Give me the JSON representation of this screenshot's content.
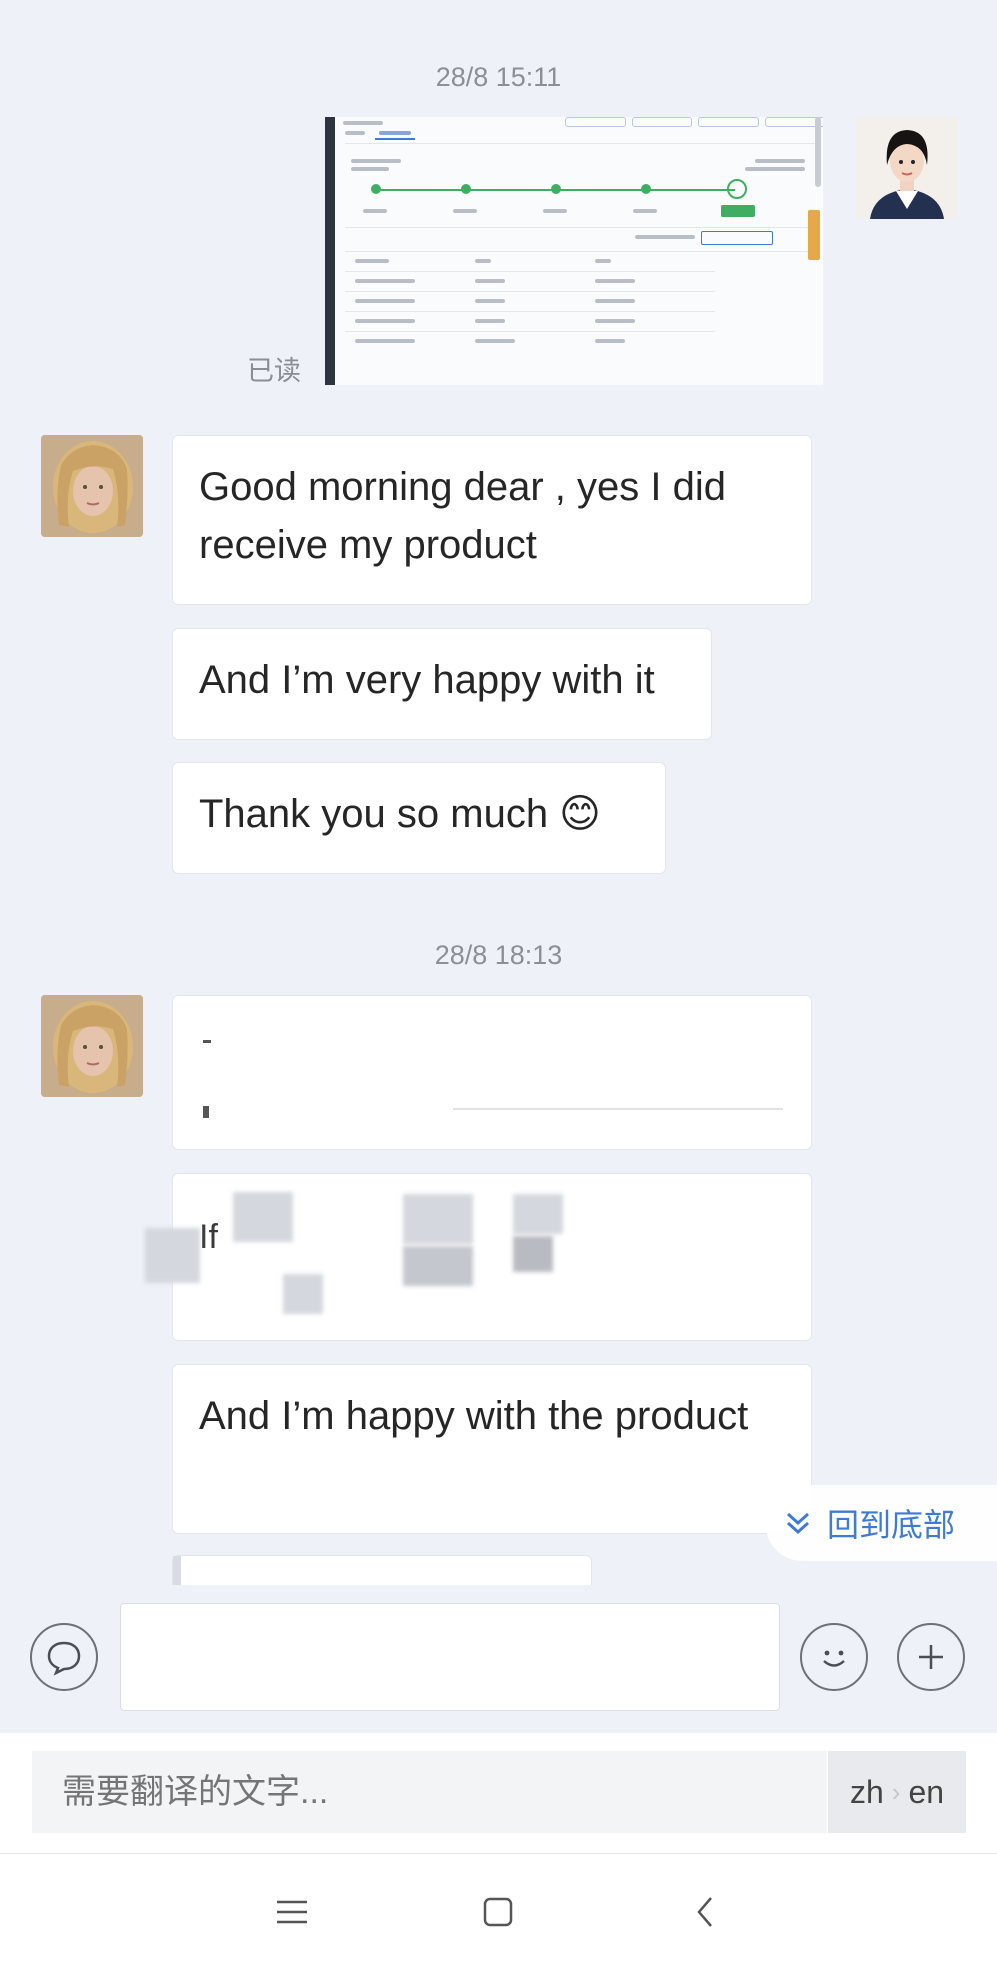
{
  "chat": {
    "timestamps": [
      "28/8 15:11",
      "28/8 18:13"
    ],
    "read_status": "已读",
    "messages": [
      "Good morning dear , yes I did receive my product",
      "And I’m very happy with it",
      "Thank you so much 😊",
      "And I’m happy with the product"
    ],
    "obscured_fragments": [
      "If"
    ]
  },
  "scroll_to_bottom": {
    "label": "回到底部",
    "icon": "double-chevron-down-icon"
  },
  "input": {
    "left_icon": "chat-bubble-icon",
    "emoji_icon": "smiley-icon",
    "plus_icon": "plus-icon"
  },
  "translate": {
    "placeholder": "需要翻译的文字...",
    "from_lang": "zh",
    "to_lang": "en"
  },
  "nav": {
    "menu_icon": "menu-icon",
    "home_icon": "home-square-icon",
    "back_icon": "back-chevron-icon"
  },
  "colors": {
    "accent": "#3f7bd6",
    "background": "#eef1f8",
    "bubble": "#ffffff"
  }
}
